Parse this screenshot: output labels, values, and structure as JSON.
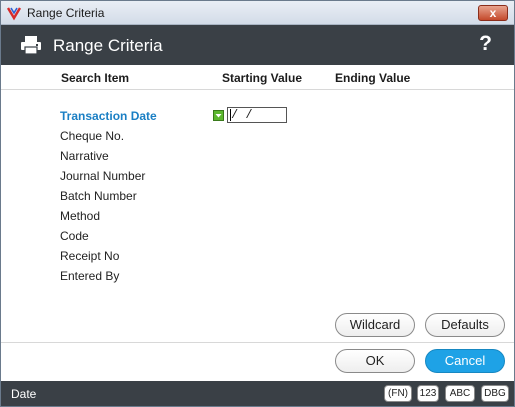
{
  "window": {
    "title": "Range Criteria",
    "close_label": "x"
  },
  "header": {
    "title": "Range Criteria",
    "help_label": "?",
    "icon": "printer-icon"
  },
  "columns": {
    "search_item": "Search Item",
    "starting_value": "Starting Value",
    "ending_value": "Ending Value"
  },
  "fields": [
    "Transaction Date",
    "Cheque No.",
    "Narrative",
    "Journal Number",
    "Batch Number",
    "Method",
    "Code",
    "Receipt No",
    "Entered By"
  ],
  "active_field_index": 0,
  "start_value": " /  /",
  "buttons": {
    "wildcard": "Wildcard",
    "defaults": "Defaults",
    "ok": "OK",
    "cancel": "Cancel"
  },
  "status": {
    "text": "Date",
    "badges": [
      "(FN)",
      "123",
      "ABC",
      "DBG"
    ]
  },
  "colors": {
    "header_bg": "#3a4046",
    "accent": "#1ea2e6",
    "active_field": "#1a7fc4",
    "check_green": "#5cb82e"
  }
}
